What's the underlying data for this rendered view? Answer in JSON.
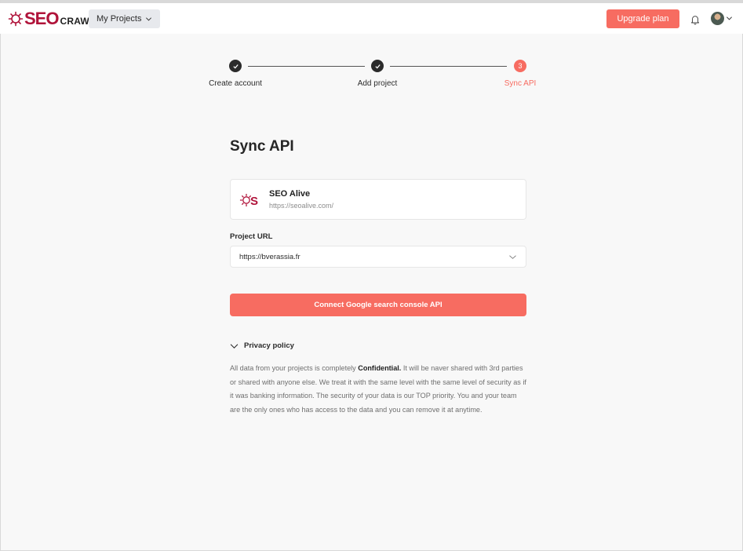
{
  "header": {
    "logo_seo": "SEO",
    "logo_crawl": "CRAWL",
    "projects_label": "My Projects",
    "upgrade_label": "Upgrade plan",
    "bell_icon": "bell-icon",
    "avatar_icon": "user-avatar"
  },
  "stepper": {
    "steps": [
      {
        "label": "Create account",
        "state": "done"
      },
      {
        "label": "Add project",
        "state": "done"
      },
      {
        "label": "Sync API",
        "state": "active",
        "number": "3"
      }
    ]
  },
  "main": {
    "title": "Sync API",
    "project": {
      "name": "SEO Alive",
      "url": "https://seoalive.com/"
    },
    "project_url_label": "Project URL",
    "project_url_value": "https://bverassia.fr",
    "connect_label": "Connect Google search console API",
    "privacy": {
      "label": "Privacy policy",
      "text_before": "All data from your projects is completely ",
      "text_bold": "Confidential.",
      "text_after": " It will be naver shared with 3rd parties or shared with anyone else. We treat it with the same level with the same level of security as if it was banking information. The security of your data is our TOP priority. You and your team are the only ones who has access to the data and you can remove it at anytime."
    }
  },
  "colors": {
    "accent": "#f76c61",
    "brand": "#b0133a",
    "dark": "#2b2b2b",
    "muted": "#6f6f6f",
    "background": "#f8f8f8"
  }
}
